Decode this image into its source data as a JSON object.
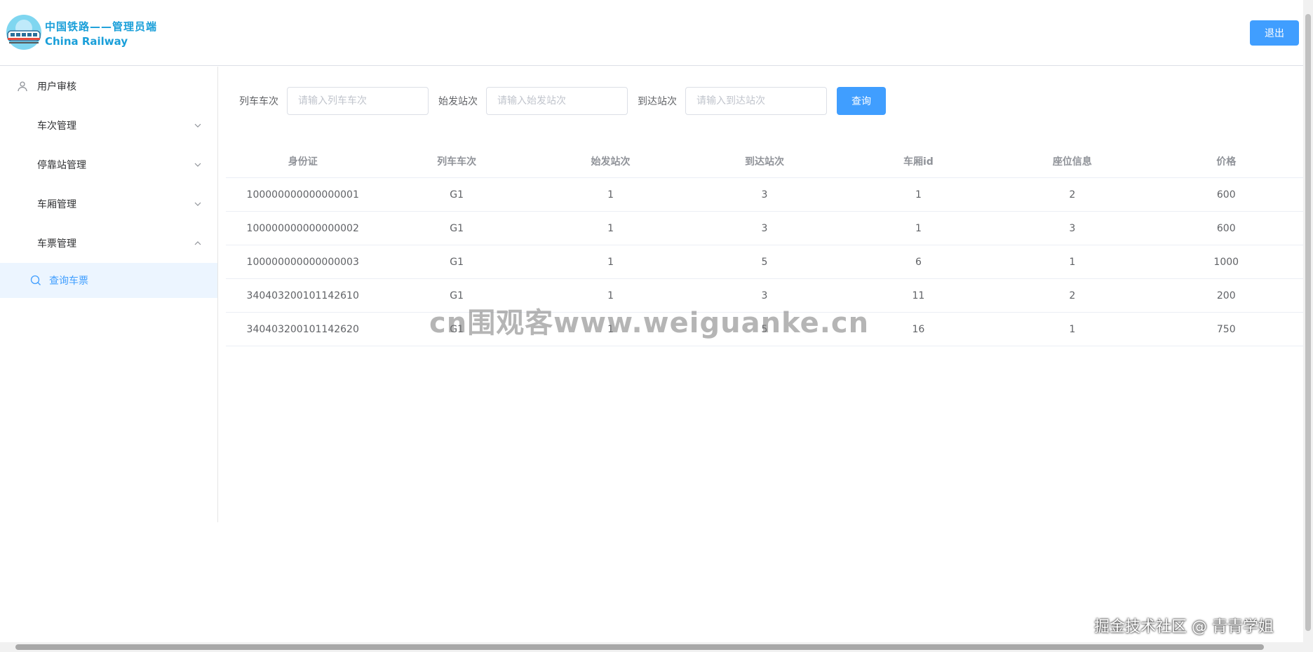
{
  "header": {
    "brand_cn": "中国铁路——管理员端",
    "brand_en": "China Railway",
    "logout_label": "退出"
  },
  "sidebar": {
    "items": [
      {
        "label": "用户审核",
        "icon": "user-icon"
      },
      {
        "label": "车次管理",
        "icon": "grid-icon",
        "expanded": false
      },
      {
        "label": "停靠站管理",
        "icon": "grid-icon",
        "expanded": false
      },
      {
        "label": "车厢管理",
        "icon": "grid-icon",
        "expanded": false
      },
      {
        "label": "车票管理",
        "icon": "grid-icon",
        "expanded": true
      }
    ],
    "sub_items": [
      {
        "label": "查询车票",
        "icon": "search-icon",
        "active": true
      }
    ]
  },
  "search": {
    "train_label": "列车车次",
    "train_placeholder": "请输入列车车次",
    "start_label": "始发站次",
    "start_placeholder": "请输入始发站次",
    "end_label": "到达站次",
    "end_placeholder": "请输入到达站次",
    "query_label": "查询"
  },
  "table": {
    "columns": [
      "身份证",
      "列车车次",
      "始发站次",
      "到达站次",
      "车厢id",
      "座位信息",
      "价格"
    ],
    "rows": [
      [
        "100000000000000001",
        "G1",
        "1",
        "3",
        "1",
        "2",
        "600"
      ],
      [
        "100000000000000002",
        "G1",
        "1",
        "3",
        "1",
        "3",
        "600"
      ],
      [
        "100000000000000003",
        "G1",
        "1",
        "5",
        "6",
        "1",
        "1000"
      ],
      [
        "340403200101142610",
        "G1",
        "1",
        "3",
        "11",
        "2",
        "200"
      ],
      [
        "340403200101142620",
        "G1",
        "1",
        "5",
        "16",
        "1",
        "750"
      ]
    ]
  },
  "watermarks": {
    "center": "cn围观客www.weiguanke.cn",
    "bottom": "掘金技术社区 @ 青青学姐"
  },
  "colors": {
    "primary": "#409eff",
    "brand": "#1a9fd9",
    "active_bg": "#ecf5ff"
  }
}
